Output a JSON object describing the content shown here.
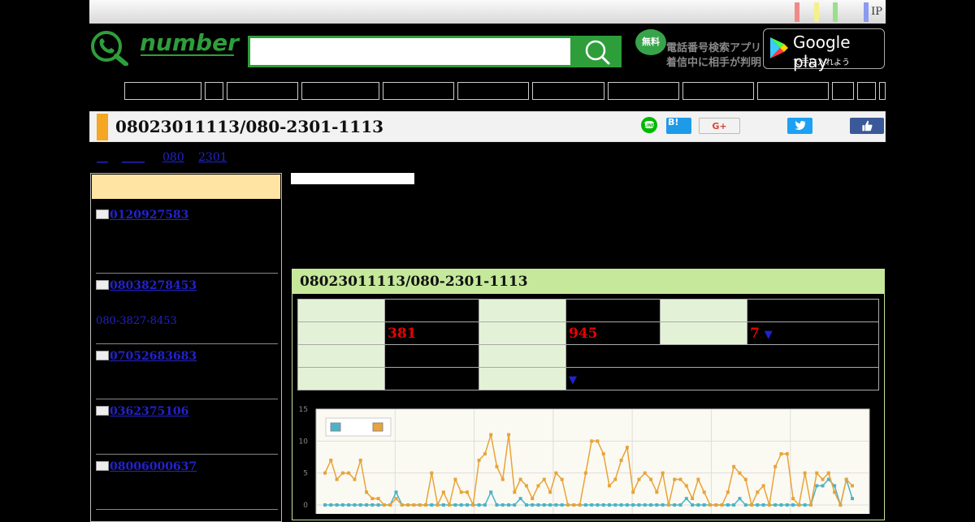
{
  "topbar": {
    "ip_label": "IP",
    "color_bars": [
      "#f08a8a",
      "#f5f08a",
      "#9ae08a",
      "#8a9af0"
    ]
  },
  "header": {
    "logo_text": "number",
    "search": {
      "value": "",
      "placeholder": ""
    },
    "app_badge": "無料",
    "app_line1": "電話番号検索アプリ",
    "app_line2": "着信中に相手が判明",
    "google_play": {
      "name": "Google play",
      "sub": "で手に入れよう"
    }
  },
  "title_bar": {
    "title": "08023011113/080-2301-1113",
    "share_hatena": "B!",
    "share_gplus": "G+"
  },
  "breadcrumb": [
    "__",
    "____",
    "080",
    "2301"
  ],
  "sidebar": {
    "items": [
      {
        "number": "0120927583",
        "sub": ""
      },
      {
        "number": "08038278453",
        "sub": "080-3827-8453"
      },
      {
        "number": "07052683683",
        "sub": ""
      },
      {
        "number": "0362375106",
        "sub": ""
      },
      {
        "number": "08006000637",
        "sub": ""
      }
    ]
  },
  "panel": {
    "title": "08023011113/080-2301-1113",
    "stats": {
      "v1": "381",
      "v2": "945",
      "v3": "7",
      "arrow": "▼"
    }
  },
  "colors": {
    "green": "#2e9e3b",
    "orange": "#f5a623",
    "teal": "#4bb3c8",
    "panel_head": "#c5e89b"
  },
  "chart_data": {
    "type": "line",
    "ylim": [
      0,
      15
    ],
    "yticks": [
      "0",
      "5",
      "10",
      "15"
    ],
    "grid": true,
    "legend": "top-left",
    "series": [
      {
        "color": "#e8a33a",
        "values": [
          5,
          7,
          4,
          5,
          5,
          4,
          7,
          2,
          1,
          1,
          0,
          0,
          1,
          0,
          0,
          0,
          0,
          0,
          5,
          0,
          2,
          0,
          4,
          2,
          2,
          0,
          7,
          8,
          11,
          6,
          4,
          11,
          2,
          4,
          3,
          1,
          3,
          4,
          2,
          5,
          4,
          0,
          0,
          0,
          5,
          10,
          10,
          8,
          3,
          4,
          7,
          9,
          2,
          4,
          5,
          4,
          2,
          5,
          0,
          4,
          4,
          3,
          1,
          4,
          2,
          0,
          0,
          0,
          2,
          6,
          5,
          4,
          0,
          2,
          3,
          0,
          6,
          8,
          8,
          1,
          0,
          5,
          0,
          5,
          4,
          5,
          2,
          0,
          4,
          3
        ]
      },
      {
        "color": "#4bb3c8",
        "values": [
          0,
          0,
          0,
          0,
          0,
          0,
          0,
          0,
          0,
          0,
          0,
          0,
          2,
          0,
          0,
          0,
          0,
          0,
          0,
          0,
          0,
          0,
          0,
          0,
          0,
          0,
          0,
          0,
          2,
          0,
          0,
          0,
          0,
          1,
          0,
          0,
          0,
          0,
          0,
          0,
          0,
          0,
          0,
          0,
          0,
          0,
          0,
          0,
          0,
          0,
          0,
          0,
          0,
          0,
          0,
          0,
          0,
          0,
          0,
          0,
          0,
          1,
          0,
          0,
          0,
          0,
          0,
          0,
          0,
          0,
          1,
          0,
          0,
          0,
          0,
          0,
          0,
          0,
          0,
          0,
          0,
          0,
          0,
          3,
          3,
          4,
          3,
          0,
          4,
          1
        ]
      }
    ]
  }
}
